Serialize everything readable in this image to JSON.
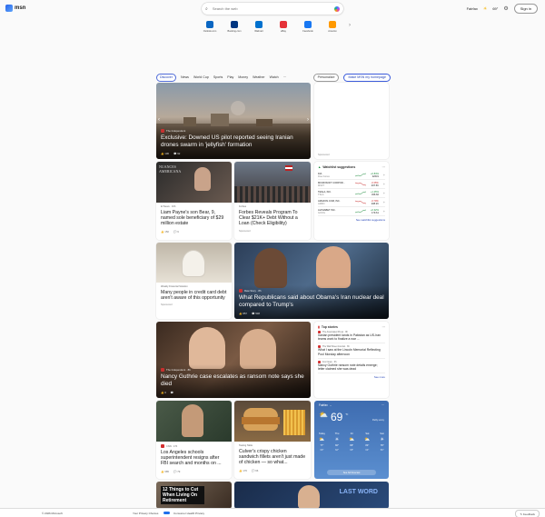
{
  "header": {
    "logo_text": "msn",
    "search_placeholder": "Search the web",
    "location": "Fairfax",
    "temperature": "69°",
    "signin_label": "Sign in"
  },
  "shortcuts": [
    {
      "label": "Outlook.com",
      "color": "#0a66c2"
    },
    {
      "label": "Booking.com",
      "color": "#003580"
    },
    {
      "label": "Walmart",
      "color": "#0071ce"
    },
    {
      "label": "eBay",
      "color": "#e53238"
    },
    {
      "label": "Facebook",
      "color": "#1877f2"
    },
    {
      "label": "Amazon",
      "color": "#ff9900"
    }
  ],
  "tabs": [
    "Discover",
    "News",
    "World Cup",
    "Sports",
    "Play",
    "Money",
    "Weather",
    "Watch",
    "···"
  ],
  "personalize_label": "Personalize",
  "makehome_label": "Make MSN my homepage",
  "hero": {
    "source": "The Independent",
    "headline": "Exclusive: Downed US pilot reported seeing Iranian drones swarm in 'jellyfish' formation",
    "likes": "136",
    "comments": "92"
  },
  "ad_top": {
    "label": "Sponsored"
  },
  "card_liam": {
    "source": "E! News · 16h",
    "headline": "Liam Payne's son Bear, 9, named sole beneficiary of $29 million estate",
    "likes": "150",
    "comments": "9",
    "banner": "NUANCES AMERICANA"
  },
  "card_forbes": {
    "source": "Forbes",
    "headline": "Forbes Reveals Program To Clear $21K+ Debt Without a Loan (Check Eligibility)",
    "sponsored": "Sponsored"
  },
  "watchlist": {
    "title": "Watchlist suggestions",
    "rows": [
      {
        "name": "DIA",
        "sub": "Dow Jones",
        "change": "+0.84%",
        "price": "42631",
        "up": true
      },
      {
        "name": "MICROSOFT CORPOR...",
        "sub": "MSFT",
        "change": "-0.35%",
        "price": "407.56",
        "up": false
      },
      {
        "name": "TESLA, INC.",
        "sub": "TSLA",
        "change": "+1.25%",
        "price": "336.66",
        "up": true
      },
      {
        "name": "AMAZON.COM, INC.",
        "sub": "AMZN",
        "change": "-0.79%",
        "price": "208.26",
        "up": false
      },
      {
        "name": "ALPHABET INC.",
        "sub": "GOOG",
        "change": "+0.32%",
        "price": "179.61",
        "up": true
      }
    ],
    "link": "See watchlist suggestions"
  },
  "card_credit": {
    "source": "Weekly Financial Solution",
    "headline": "Many people in credit card debt aren't aware of this opportunity",
    "sponsored": "Sponsored"
  },
  "card_obama": {
    "source": "Raw Story · 8h",
    "headline": "What Republicans said about Obama's Iran nuclear deal compared to Trump's",
    "likes": "857",
    "comments": "508"
  },
  "card_guthrie": {
    "source": "The Independent · 8h",
    "headline": "Nancy Guthrie case escalates as ransom note says she died",
    "likes": "0"
  },
  "top_stories": {
    "title": "Top stories",
    "items": [
      {
        "source": "The Associated Press · 8h",
        "headline": "Iranian president lands in Pakistan as US-Iran teams work to finalize a war ..."
      },
      {
        "source": "The Wall Street Journal · 3h",
        "headline": "What I saw at the Lincoln Memorial Reflecting Pool Monday afternoon"
      },
      {
        "source": "Fox News · 6h",
        "headline": "Nancy Guthrie ransom note details emerge; letter claimed she was dead"
      }
    ],
    "see_more": "See more"
  },
  "card_lausd": {
    "source": "CNN · 17h",
    "headline": "Los Angeles schools superintendent resigns after FBI search and months on ...",
    "likes": "985",
    "comments": "79"
  },
  "card_culvers": {
    "source": "Tasting Table",
    "headline": "Culver's crispy chicken sandwich fillets aren't just made of chicken — so what...",
    "likes": "176",
    "comments": "66"
  },
  "weather": {
    "location": "Fairfax",
    "temp": "69",
    "unit": "°F",
    "desc": "Partly sunny",
    "days": [
      {
        "day": "Today",
        "hi": "77°",
        "lo": "60°",
        "icon": "⛅"
      },
      {
        "day": "Thu",
        "hi": "82°",
        "lo": "62°",
        "icon": "☀"
      },
      {
        "day": "Fri",
        "hi": "86°",
        "lo": "65°",
        "icon": "⛅"
      },
      {
        "day": "Sat",
        "hi": "84°",
        "lo": "64°",
        "icon": "⛅"
      },
      {
        "day": "Sun",
        "hi": "78°",
        "lo": "59°",
        "icon": "☀"
      }
    ],
    "button": "See full forecast"
  },
  "card_retirement": {
    "banner": "12 Things to Cut When Living On Retirement"
  },
  "card_lastword": {
    "banner": "LAST WORD"
  },
  "footer": {
    "copyright": "© 2026 Microsoft",
    "privacy": "Your Privacy Choices",
    "consumer": "Consumer Health Privacy",
    "feedback": "Feedback"
  }
}
